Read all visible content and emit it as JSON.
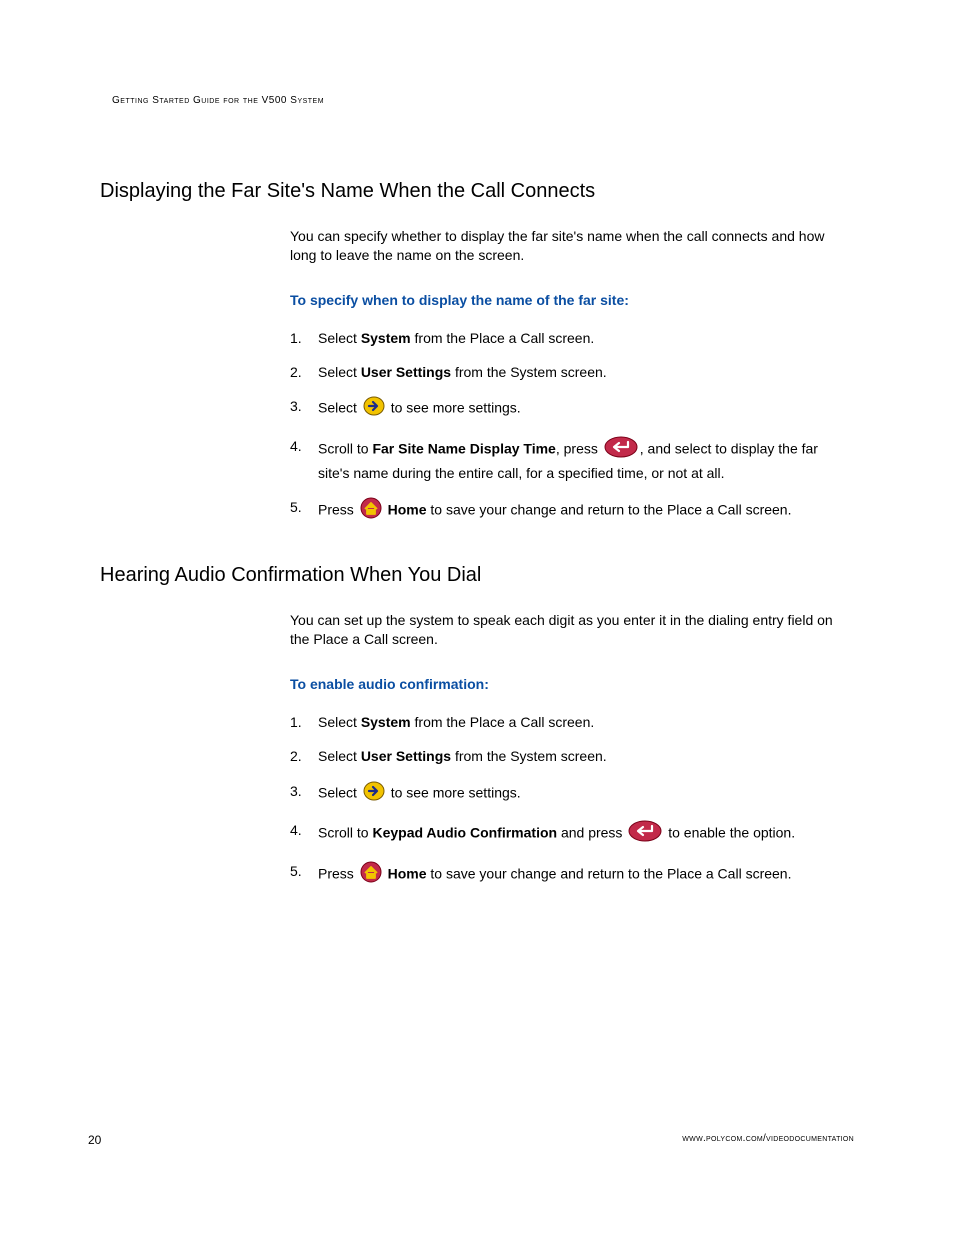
{
  "header": {
    "running": "Getting Started Guide for the V500 System"
  },
  "sections": [
    {
      "title": "Displaying the Far Site's Name When the Call Connects",
      "intro": "You can specify whether to display the far site's name when the call connects and how long to leave the name on the screen.",
      "task": "To specify when to display the name of the far site:",
      "steps": {
        "s1a": "Select ",
        "s1b": "System",
        "s1c": " from the Place a Call screen.",
        "s2a": "Select ",
        "s2b": "User Settings",
        "s2c": " from the System screen.",
        "s3a": "Select ",
        "s3b": " to see more settings.",
        "s4a": "Scroll to ",
        "s4b": "Far Site Name Display Time",
        "s4c": ", press ",
        "s4d": ", and select to display the far site's name during the entire call, for a specified time, or not at all.",
        "s5a": "Press ",
        "s5b": " Home",
        "s5c": " to save your change and return to the Place a Call screen."
      }
    },
    {
      "title": "Hearing Audio Confirmation When You Dial",
      "intro": "You can set up the system to speak each digit as you enter it in the dialing entry field on the Place a Call screen.",
      "task": "To enable audio confirmation:",
      "steps": {
        "s1a": "Select ",
        "s1b": "System",
        "s1c": " from the Place a Call screen.",
        "s2a": "Select ",
        "s2b": "User Settings",
        "s2c": " from the System screen.",
        "s3a": "Select ",
        "s3b": " to see more settings.",
        "s4a": "Scroll to ",
        "s4b": "Keypad Audio Confirmation",
        "s4c": " and press ",
        "s4d": " to enable the option.",
        "s5a": "Press ",
        "s5b": " Home",
        "s5c": " to save your change and return to the Place a Call screen."
      }
    }
  ],
  "footer": {
    "page": "20",
    "url": "www.polycom.com/videodocumentation"
  },
  "icons": {
    "arrow": "arrow-right-icon",
    "enter": "enter-icon",
    "home": "home-icon"
  }
}
